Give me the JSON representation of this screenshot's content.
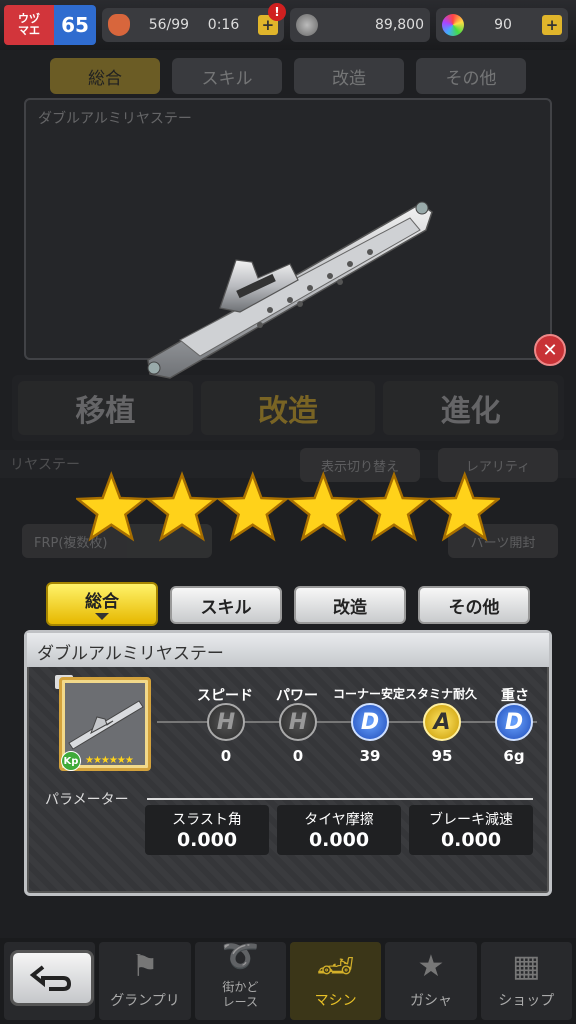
{
  "status_bar": {
    "rank_label": "ウヅ\nマエ",
    "rank_value": "65",
    "stamina": "56/99",
    "timer": "0:16",
    "alert": "!",
    "coins": "89,800",
    "gems": "90",
    "plus": "+"
  },
  "background": {
    "tabs": [
      "総合",
      "スキル",
      "改造",
      "その他"
    ],
    "panel_title": "ダブルアルミリヤステー",
    "actions": [
      "移植",
      "改造",
      "進化"
    ],
    "lower_header": "リヤステー",
    "chips": [
      "表示切り替え",
      "レアリティ",
      "FRP(複数枚)",
      "パーツ開封"
    ]
  },
  "rarity_stars": 6,
  "tabs": {
    "overall": "総合",
    "skill": "スキル",
    "modify": "改造",
    "other": "その他"
  },
  "part": {
    "name": "ダブルアルミリヤステー",
    "kp_label": "Kp",
    "thumb_stars": "★★★★★★"
  },
  "stats": {
    "headers": [
      "スピード",
      "パワー",
      "コーナー安定",
      "スタミナ耐久",
      "重さ"
    ],
    "grades": [
      "H",
      "H",
      "D",
      "A",
      "D"
    ],
    "values": [
      "0",
      "0",
      "39",
      "95",
      "6g"
    ]
  },
  "parameters": {
    "label": "パラメーター",
    "items": [
      {
        "name": "スラスト角",
        "value": "0.000"
      },
      {
        "name": "タイヤ摩擦",
        "value": "0.000"
      },
      {
        "name": "ブレーキ減速",
        "value": "0.000"
      }
    ]
  },
  "nav": {
    "items": [
      "グランプリ",
      "街かど\nレース",
      "マシン",
      "ガシャ",
      "ショップ"
    ]
  },
  "colors": {
    "gold": "#e6b800",
    "grade_d": "#1f4bb8",
    "grade_a": "#c99a00",
    "close": "#c83236"
  }
}
